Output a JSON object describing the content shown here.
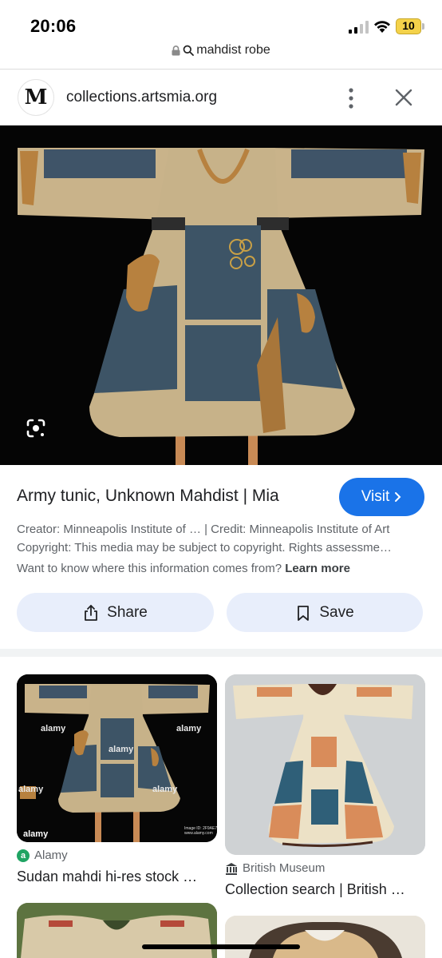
{
  "status": {
    "time": "20:06",
    "battery": "10",
    "battery_color": "#f4d24a"
  },
  "browser": {
    "url_text": "mahdist robe",
    "icons": [
      "lock-icon",
      "search-icon"
    ]
  },
  "source": {
    "logo_mark": "M",
    "domain": "collections.artsmia.org",
    "icons": [
      "more-vertical-icon",
      "close-icon"
    ]
  },
  "image_overlay": {
    "icon": "google-lens-icon"
  },
  "details": {
    "title": "Army tunic, Unknown Mahdist | Mia",
    "visit_label": "Visit",
    "meta_line_1": "Creator: Minneapolis Institute of … | Credit: Minneapolis Institute of Art",
    "meta_line_2": "Copyright: This media may be subject to copyright. Rights assessme…",
    "meta_line_3_prefix": "Want to know where this information comes from? ",
    "learn_more": "Learn more",
    "share_label": "Share",
    "save_label": "Save",
    "accent": "#1a73e8"
  },
  "results": [
    {
      "source": "Alamy",
      "source_badge": "a",
      "title": "Sudan mahdi hi-res stock …",
      "watermark": "alamy",
      "caption": "Image ID: 2F9AE7J\nwww.alamy.com"
    },
    {
      "source": "British Museum",
      "title": "Collection search | British …"
    }
  ]
}
